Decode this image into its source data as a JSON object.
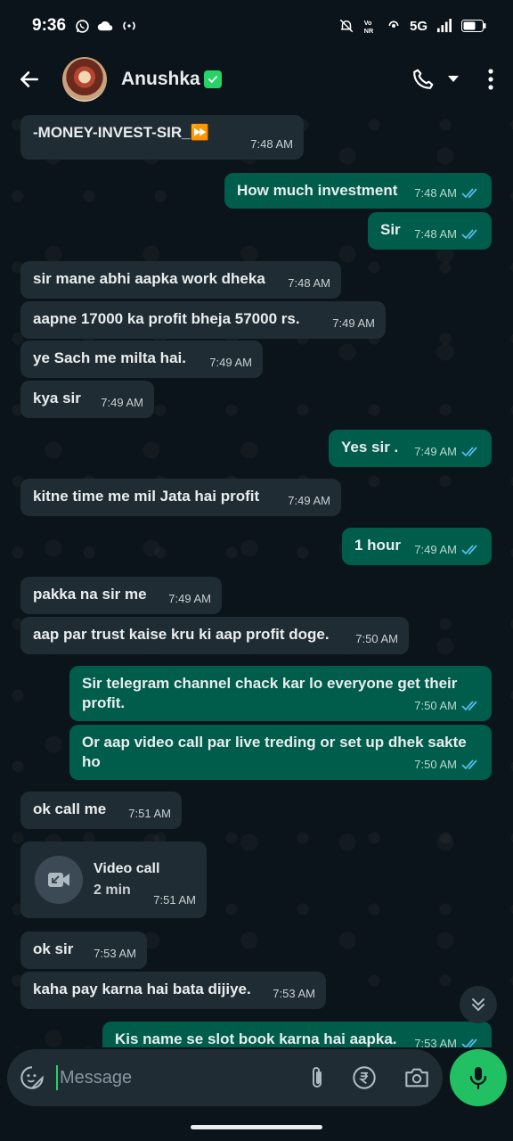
{
  "status_bar": {
    "time": "9:36",
    "network": "5G",
    "icons": [
      "whatsapp-icon",
      "cloud-icon",
      "hotspot-icon",
      "mute-icon",
      "volte-icon",
      "wifi-call-icon",
      "signal-icon",
      "battery-icon"
    ]
  },
  "header": {
    "contact_name": "Anushka",
    "verified_badge": true
  },
  "messages": [
    {
      "dir": "in",
      "text": "-MONEY-INVEST-SIR_⏩",
      "time": "7:48 AM"
    },
    {
      "dir": "out",
      "text": "How much investment",
      "time": "7:48 AM",
      "read": true
    },
    {
      "dir": "out",
      "text": "Sir",
      "time": "7:48 AM",
      "read": true
    },
    {
      "dir": "in",
      "text": "sir mane abhi aapka work dheka",
      "time": "7:48 AM"
    },
    {
      "dir": "in",
      "text": "aapne 17000 ka profit bheja 57000 rs.",
      "time": "7:49 AM"
    },
    {
      "dir": "in",
      "text": "ye Sach me milta hai.",
      "time": "7:49 AM"
    },
    {
      "dir": "in",
      "text": "kya sir",
      "time": "7:49 AM"
    },
    {
      "dir": "out",
      "text": "Yes sir .",
      "time": "7:49 AM",
      "read": true
    },
    {
      "dir": "in",
      "text": "kitne time me mil Jata hai profit",
      "time": "7:49 AM"
    },
    {
      "dir": "out",
      "text": "1 hour",
      "time": "7:49 AM",
      "read": true
    },
    {
      "dir": "in",
      "text": "pakka na sir me",
      "time": "7:49 AM"
    },
    {
      "dir": "in",
      "text": "aap par trust kaise kru ki aap profit doge.",
      "time": "7:50 AM"
    },
    {
      "dir": "out",
      "text": "Sir telegram channel chack kar lo everyone get their profit.",
      "time": "7:50 AM",
      "read": true
    },
    {
      "dir": "out",
      "text": "Or aap video call par live treding or set up dhek sakte ho",
      "time": "7:50 AM",
      "read": true
    },
    {
      "dir": "in",
      "text": "ok call me",
      "time": "7:51 AM"
    },
    {
      "dir": "in",
      "type": "call",
      "title": "Video call",
      "duration": "2 min",
      "time": "7:51 AM"
    },
    {
      "dir": "in",
      "text": "ok sir",
      "time": "7:53 AM"
    },
    {
      "dir": "in",
      "text": "kaha pay karna hai bata dijiye.",
      "time": "7:53 AM"
    },
    {
      "dir": "out",
      "text": "Kis name se slot book karna hai aapka.",
      "time": "7:53 AM",
      "read": true
    }
  ],
  "composer": {
    "placeholder": "Message"
  },
  "colors": {
    "background": "#0b141a",
    "incoming_bubble": "#202c33",
    "outgoing_bubble": "#005c4b",
    "accent": "#21c063",
    "read_ticks": "#53bdeb"
  }
}
